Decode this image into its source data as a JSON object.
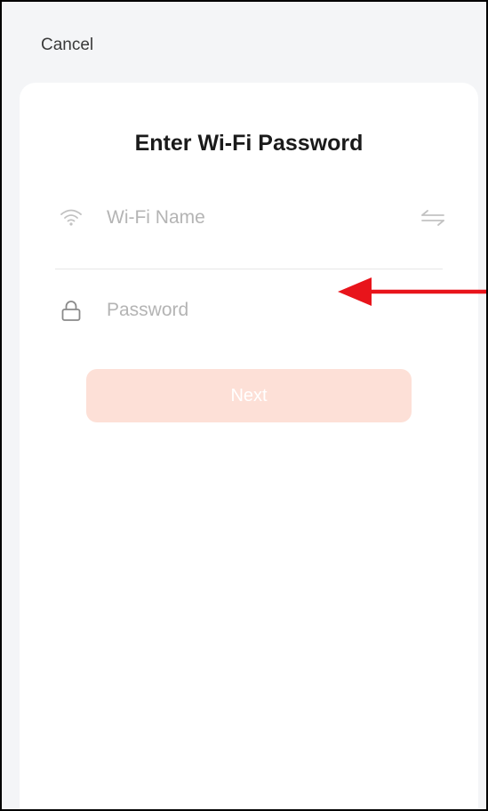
{
  "header": {
    "cancel_label": "Cancel"
  },
  "card": {
    "title": "Enter Wi-Fi Password",
    "wifi_field": {
      "placeholder": "Wi-Fi Name",
      "value": "",
      "icon": "wifi-icon",
      "action_icon": "swap-icon"
    },
    "password_field": {
      "placeholder": "Password",
      "value": "",
      "icon": "lock-icon"
    },
    "next_label": "Next"
  },
  "colors": {
    "background": "#f4f5f7",
    "card": "#ffffff",
    "next_button_disabled": "#fde0d7",
    "placeholder": "#b4b4b4",
    "annotation_arrow": "#e8141b"
  }
}
